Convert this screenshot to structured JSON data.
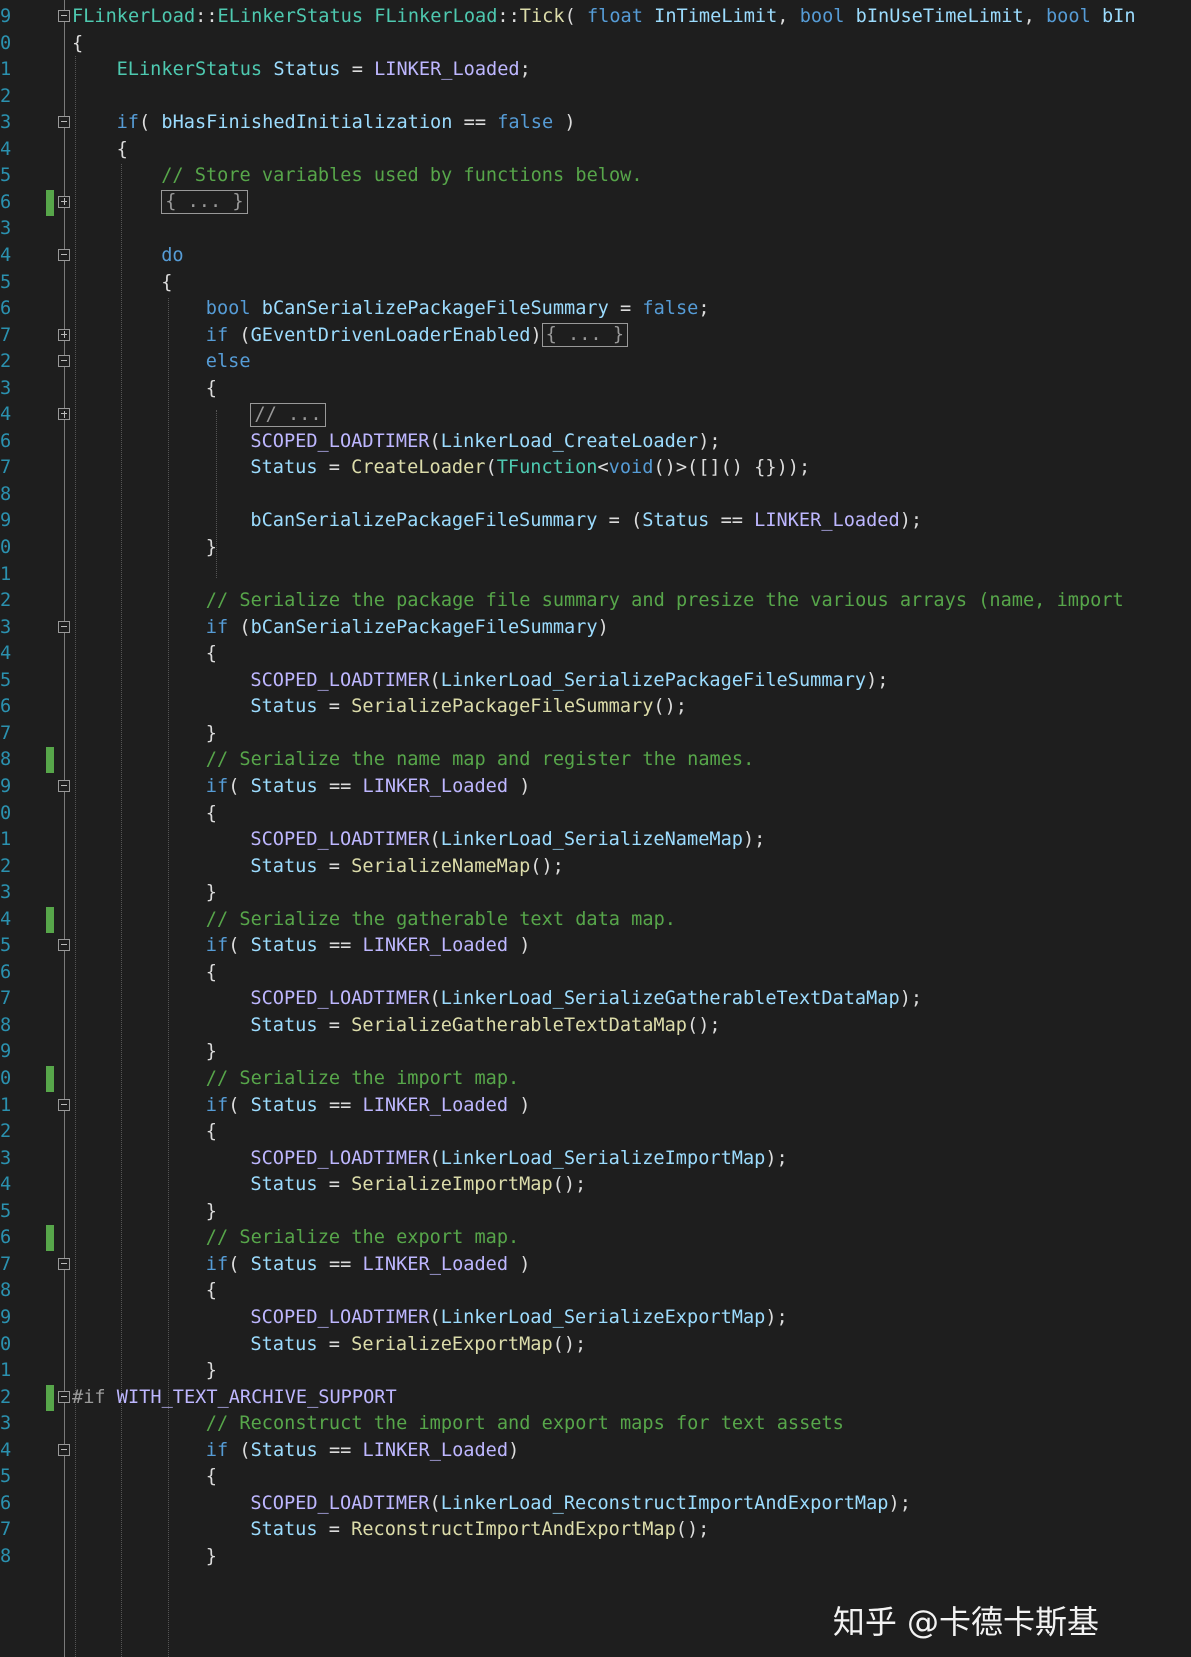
{
  "editor": {
    "lines": [
      {
        "num": "9",
        "indent": 0,
        "fold": "minus",
        "marker": false,
        "tokens": [
          [
            "tp",
            "FLinkerLoad"
          ],
          [
            "pl",
            "::"
          ],
          [
            "tp",
            "ELinkerStatus"
          ],
          [
            "pl",
            " "
          ],
          [
            "tp",
            "FLinkerLoad"
          ],
          [
            "pl",
            "::"
          ],
          [
            "fn",
            "Tick"
          ],
          [
            "pl",
            "( "
          ],
          [
            "kw",
            "float"
          ],
          [
            "pl",
            " "
          ],
          [
            "var",
            "InTimeLimit"
          ],
          [
            "pl",
            ", "
          ],
          [
            "kw",
            "bool"
          ],
          [
            "pl",
            " "
          ],
          [
            "var",
            "bInUseTimeLimit"
          ],
          [
            "pl",
            ", "
          ],
          [
            "kw",
            "bool"
          ],
          [
            "pl",
            " "
          ],
          [
            "var",
            "bIn"
          ]
        ]
      },
      {
        "num": "0",
        "indent": 0,
        "tokens": [
          [
            "pl",
            "{"
          ]
        ]
      },
      {
        "num": "1",
        "indent": 1,
        "tokens": [
          [
            "tp",
            "ELinkerStatus"
          ],
          [
            "pl",
            " "
          ],
          [
            "var",
            "Status"
          ],
          [
            "pl",
            " = "
          ],
          [
            "mac",
            "LINKER_Loaded"
          ],
          [
            "pl",
            ";"
          ]
        ]
      },
      {
        "num": "2",
        "indent": 0,
        "tokens": []
      },
      {
        "num": "3",
        "indent": 1,
        "fold": "minus",
        "tokens": [
          [
            "kw",
            "if"
          ],
          [
            "pl",
            "( "
          ],
          [
            "var",
            "bHasFinishedInitialization"
          ],
          [
            "pl",
            " == "
          ],
          [
            "kw",
            "false"
          ],
          [
            "pl",
            " )"
          ]
        ]
      },
      {
        "num": "4",
        "indent": 1,
        "tokens": [
          [
            "pl",
            "{"
          ]
        ]
      },
      {
        "num": "5",
        "indent": 2,
        "tokens": [
          [
            "cm",
            "// Store variables used by functions below."
          ]
        ]
      },
      {
        "num": "6",
        "indent": 2,
        "fold": "plus",
        "marker": true,
        "tokens": [
          [
            "box",
            "{ ... }"
          ]
        ]
      },
      {
        "num": "3",
        "indent": 0,
        "tokens": []
      },
      {
        "num": "4",
        "indent": 2,
        "fold": "minus",
        "tokens": [
          [
            "kw",
            "do"
          ]
        ]
      },
      {
        "num": "5",
        "indent": 2,
        "tokens": [
          [
            "pl",
            "{"
          ]
        ]
      },
      {
        "num": "6",
        "indent": 3,
        "tokens": [
          [
            "kw",
            "bool"
          ],
          [
            "pl",
            " "
          ],
          [
            "var",
            "bCanSerializePackageFileSummary"
          ],
          [
            "pl",
            " = "
          ],
          [
            "kw",
            "false"
          ],
          [
            "pl",
            ";"
          ]
        ]
      },
      {
        "num": "7",
        "indent": 3,
        "fold": "plus",
        "tokens": [
          [
            "kw",
            "if"
          ],
          [
            "pl",
            " ("
          ],
          [
            "var",
            "GEventDrivenLoaderEnabled"
          ],
          [
            "pl",
            ")"
          ],
          [
            "box",
            "{ ... }"
          ]
        ]
      },
      {
        "num": "2",
        "indent": 3,
        "fold": "minus",
        "tokens": [
          [
            "kw",
            "else"
          ]
        ]
      },
      {
        "num": "3",
        "indent": 3,
        "tokens": [
          [
            "pl",
            "{"
          ]
        ]
      },
      {
        "num": "4",
        "indent": 4,
        "fold": "plus",
        "tokens": [
          [
            "box",
            "// ..."
          ]
        ]
      },
      {
        "num": "6",
        "indent": 4,
        "tokens": [
          [
            "mac",
            "SCOPED_LOADTIMER"
          ],
          [
            "pl",
            "("
          ],
          [
            "var",
            "LinkerLoad_CreateLoader"
          ],
          [
            "pl",
            ");"
          ]
        ]
      },
      {
        "num": "7",
        "indent": 4,
        "tokens": [
          [
            "var",
            "Status"
          ],
          [
            "pl",
            " = "
          ],
          [
            "fn",
            "CreateLoader"
          ],
          [
            "pl",
            "("
          ],
          [
            "tp",
            "TFunction"
          ],
          [
            "pl",
            "<"
          ],
          [
            "kw",
            "void"
          ],
          [
            "pl",
            "()>([]() {}));"
          ]
        ]
      },
      {
        "num": "8",
        "indent": 0,
        "tokens": []
      },
      {
        "num": "9",
        "indent": 4,
        "tokens": [
          [
            "var",
            "bCanSerializePackageFileSummary"
          ],
          [
            "pl",
            " = ("
          ],
          [
            "var",
            "Status"
          ],
          [
            "pl",
            " == "
          ],
          [
            "mac",
            "LINKER_Loaded"
          ],
          [
            "pl",
            ");"
          ]
        ]
      },
      {
        "num": "0",
        "indent": 3,
        "tokens": [
          [
            "pl",
            "}"
          ]
        ]
      },
      {
        "num": "1",
        "indent": 0,
        "tokens": []
      },
      {
        "num": "2",
        "indent": 3,
        "tokens": [
          [
            "cm",
            "// Serialize the package file summary and presize the various arrays (name, import"
          ]
        ]
      },
      {
        "num": "3",
        "indent": 3,
        "fold": "minus",
        "tokens": [
          [
            "kw",
            "if"
          ],
          [
            "pl",
            " ("
          ],
          [
            "var",
            "bCanSerializePackageFileSummary"
          ],
          [
            "pl",
            ")"
          ]
        ]
      },
      {
        "num": "4",
        "indent": 3,
        "tokens": [
          [
            "pl",
            "{"
          ]
        ]
      },
      {
        "num": "5",
        "indent": 4,
        "tokens": [
          [
            "mac",
            "SCOPED_LOADTIMER"
          ],
          [
            "pl",
            "("
          ],
          [
            "var",
            "LinkerLoad_SerializePackageFileSummary"
          ],
          [
            "pl",
            ");"
          ]
        ]
      },
      {
        "num": "6",
        "indent": 4,
        "tokens": [
          [
            "var",
            "Status"
          ],
          [
            "pl",
            " = "
          ],
          [
            "fn",
            "SerializePackageFileSummary"
          ],
          [
            "pl",
            "();"
          ]
        ]
      },
      {
        "num": "7",
        "indent": 3,
        "tokens": [
          [
            "pl",
            "}"
          ]
        ]
      },
      {
        "num": "8",
        "indent": 3,
        "marker": true,
        "tokens": [
          [
            "cm",
            "// Serialize the name map and register the names."
          ]
        ]
      },
      {
        "num": "9",
        "indent": 3,
        "fold": "minus",
        "tokens": [
          [
            "kw",
            "if"
          ],
          [
            "pl",
            "( "
          ],
          [
            "var",
            "Status"
          ],
          [
            "pl",
            " == "
          ],
          [
            "mac",
            "LINKER_Loaded"
          ],
          [
            "pl",
            " )"
          ]
        ]
      },
      {
        "num": "0",
        "indent": 3,
        "tokens": [
          [
            "pl",
            "{"
          ]
        ]
      },
      {
        "num": "1",
        "indent": 4,
        "tokens": [
          [
            "mac",
            "SCOPED_LOADTIMER"
          ],
          [
            "pl",
            "("
          ],
          [
            "var",
            "LinkerLoad_SerializeNameMap"
          ],
          [
            "pl",
            ");"
          ]
        ]
      },
      {
        "num": "2",
        "indent": 4,
        "tokens": [
          [
            "var",
            "Status"
          ],
          [
            "pl",
            " = "
          ],
          [
            "fn",
            "SerializeNameMap"
          ],
          [
            "pl",
            "();"
          ]
        ]
      },
      {
        "num": "3",
        "indent": 3,
        "tokens": [
          [
            "pl",
            "}"
          ]
        ]
      },
      {
        "num": "4",
        "indent": 3,
        "marker": true,
        "tokens": [
          [
            "cm",
            "// Serialize the gatherable text data map."
          ]
        ]
      },
      {
        "num": "5",
        "indent": 3,
        "fold": "minus",
        "tokens": [
          [
            "kw",
            "if"
          ],
          [
            "pl",
            "( "
          ],
          [
            "var",
            "Status"
          ],
          [
            "pl",
            " == "
          ],
          [
            "mac",
            "LINKER_Loaded"
          ],
          [
            "pl",
            " )"
          ]
        ]
      },
      {
        "num": "6",
        "indent": 3,
        "tokens": [
          [
            "pl",
            "{"
          ]
        ]
      },
      {
        "num": "7",
        "indent": 4,
        "tokens": [
          [
            "mac",
            "SCOPED_LOADTIMER"
          ],
          [
            "pl",
            "("
          ],
          [
            "var",
            "LinkerLoad_SerializeGatherableTextDataMap"
          ],
          [
            "pl",
            ");"
          ]
        ]
      },
      {
        "num": "8",
        "indent": 4,
        "tokens": [
          [
            "var",
            "Status"
          ],
          [
            "pl",
            " = "
          ],
          [
            "fn",
            "SerializeGatherableTextDataMap"
          ],
          [
            "pl",
            "();"
          ]
        ]
      },
      {
        "num": "9",
        "indent": 3,
        "tokens": [
          [
            "pl",
            "}"
          ]
        ]
      },
      {
        "num": "0",
        "indent": 3,
        "marker": true,
        "tokens": [
          [
            "cm",
            "// Serialize the import map."
          ]
        ]
      },
      {
        "num": "1",
        "indent": 3,
        "fold": "minus",
        "tokens": [
          [
            "kw",
            "if"
          ],
          [
            "pl",
            "( "
          ],
          [
            "var",
            "Status"
          ],
          [
            "pl",
            " == "
          ],
          [
            "mac",
            "LINKER_Loaded"
          ],
          [
            "pl",
            " )"
          ]
        ]
      },
      {
        "num": "2",
        "indent": 3,
        "tokens": [
          [
            "pl",
            "{"
          ]
        ]
      },
      {
        "num": "3",
        "indent": 4,
        "tokens": [
          [
            "mac",
            "SCOPED_LOADTIMER"
          ],
          [
            "pl",
            "("
          ],
          [
            "var",
            "LinkerLoad_SerializeImportMap"
          ],
          [
            "pl",
            ");"
          ]
        ]
      },
      {
        "num": "4",
        "indent": 4,
        "tokens": [
          [
            "var",
            "Status"
          ],
          [
            "pl",
            " = "
          ],
          [
            "fn",
            "SerializeImportMap"
          ],
          [
            "pl",
            "();"
          ]
        ]
      },
      {
        "num": "5",
        "indent": 3,
        "tokens": [
          [
            "pl",
            "}"
          ]
        ]
      },
      {
        "num": "6",
        "indent": 3,
        "marker": true,
        "tokens": [
          [
            "cm",
            "// Serialize the export map."
          ]
        ]
      },
      {
        "num": "7",
        "indent": 3,
        "fold": "minus",
        "tokens": [
          [
            "kw",
            "if"
          ],
          [
            "pl",
            "( "
          ],
          [
            "var",
            "Status"
          ],
          [
            "pl",
            " == "
          ],
          [
            "mac",
            "LINKER_Loaded"
          ],
          [
            "pl",
            " )"
          ]
        ]
      },
      {
        "num": "8",
        "indent": 3,
        "tokens": [
          [
            "pl",
            "{"
          ]
        ]
      },
      {
        "num": "9",
        "indent": 4,
        "tokens": [
          [
            "mac",
            "SCOPED_LOADTIMER"
          ],
          [
            "pl",
            "("
          ],
          [
            "var",
            "LinkerLoad_SerializeExportMap"
          ],
          [
            "pl",
            ");"
          ]
        ]
      },
      {
        "num": "0",
        "indent": 4,
        "tokens": [
          [
            "var",
            "Status"
          ],
          [
            "pl",
            " = "
          ],
          [
            "fn",
            "SerializeExportMap"
          ],
          [
            "pl",
            "();"
          ]
        ]
      },
      {
        "num": "1",
        "indent": 3,
        "tokens": [
          [
            "pl",
            "}"
          ]
        ]
      },
      {
        "num": "2",
        "indent": 0,
        "fold": "minus",
        "marker": true,
        "tokens": [
          [
            "pp",
            "#if"
          ],
          [
            "pl",
            " "
          ],
          [
            "mac",
            "WITH_TEXT_ARCHIVE_SUPPORT"
          ]
        ]
      },
      {
        "num": "3",
        "indent": 3,
        "tokens": [
          [
            "cm",
            "// Reconstruct the import and export maps for text assets"
          ]
        ]
      },
      {
        "num": "4",
        "indent": 3,
        "fold": "minus",
        "tokens": [
          [
            "kw",
            "if"
          ],
          [
            "pl",
            " ("
          ],
          [
            "var",
            "Status"
          ],
          [
            "pl",
            " == "
          ],
          [
            "mac",
            "LINKER_Loaded"
          ],
          [
            "pl",
            ")"
          ]
        ]
      },
      {
        "num": "5",
        "indent": 3,
        "tokens": [
          [
            "pl",
            "{"
          ]
        ]
      },
      {
        "num": "6",
        "indent": 4,
        "tokens": [
          [
            "mac",
            "SCOPED_LOADTIMER"
          ],
          [
            "pl",
            "("
          ],
          [
            "var",
            "LinkerLoad_ReconstructImportAndExportMap"
          ],
          [
            "pl",
            ");"
          ]
        ]
      },
      {
        "num": "7",
        "indent": 4,
        "tokens": [
          [
            "var",
            "Status"
          ],
          [
            "pl",
            " = "
          ],
          [
            "fn",
            "ReconstructImportAndExportMap"
          ],
          [
            "pl",
            "();"
          ]
        ]
      },
      {
        "num": "8",
        "indent": 3,
        "tokens": [
          [
            "pl",
            "}"
          ]
        ]
      }
    ]
  },
  "watermark": "知乎 @卡德卡斯基"
}
